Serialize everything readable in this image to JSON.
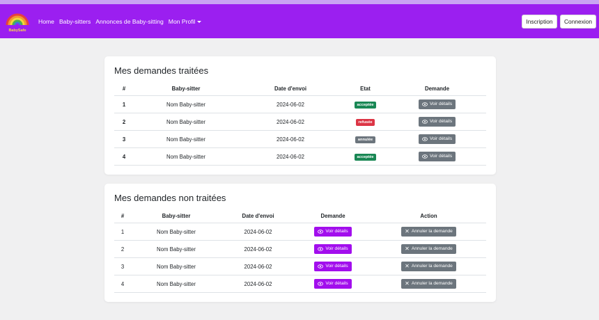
{
  "nav": {
    "logo_text": "BabySafe",
    "links": [
      "Home",
      "Baby-sitters",
      "Annonces de Baby-sitting",
      "Mon Profil"
    ],
    "signup_label": "Inscription",
    "login_label": "Connexion"
  },
  "treated": {
    "title": "Mes demandes traitées",
    "headers": [
      "#",
      "Baby-sitter",
      "Date d'envoi",
      "Etat",
      "Demande"
    ],
    "rows": [
      {
        "num": "1",
        "sitter": "Nom Baby-sitter",
        "date": "2024-06-02",
        "status": "acceptée",
        "details": "Voir détails"
      },
      {
        "num": "2",
        "sitter": "Nom Baby-sitter",
        "date": "2024-06-02",
        "status": "refusée",
        "details": "Voir détails"
      },
      {
        "num": "3",
        "sitter": "Nom Baby-sitter",
        "date": "2024-06-02",
        "status": "annulée",
        "details": "Voir détails"
      },
      {
        "num": "4",
        "sitter": "Nom Baby-sitter",
        "date": "2024-06-02",
        "status": "acceptée",
        "details": "Voir détails"
      }
    ]
  },
  "pending": {
    "title": "Mes demandes non traitées",
    "headers": [
      "#",
      "Baby-sitter",
      "Date d'envoi",
      "Demande",
      "Action"
    ],
    "rows": [
      {
        "num": "1",
        "sitter": "Nom Baby-sitter",
        "date": "2024-06-02",
        "details": "Voir détails",
        "cancel": "Annuler la demande"
      },
      {
        "num": "2",
        "sitter": "Nom Baby-sitter",
        "date": "2024-06-02",
        "details": "Voir détails",
        "cancel": "Annuler la demande"
      },
      {
        "num": "3",
        "sitter": "Nom Baby-sitter",
        "date": "2024-06-02",
        "details": "Voir détails",
        "cancel": "Annuler la demande"
      },
      {
        "num": "4",
        "sitter": "Nom Baby-sitter",
        "date": "2024-06-02",
        "details": "Voir détails",
        "cancel": "Annuler la demande"
      }
    ]
  },
  "colors": {
    "navbar": "#9b1ff0",
    "accepted": "#198754",
    "refused": "#dc3545",
    "cancelled": "#6c757d",
    "details_purple": "#a20eed",
    "grey_button": "#6c757d"
  }
}
